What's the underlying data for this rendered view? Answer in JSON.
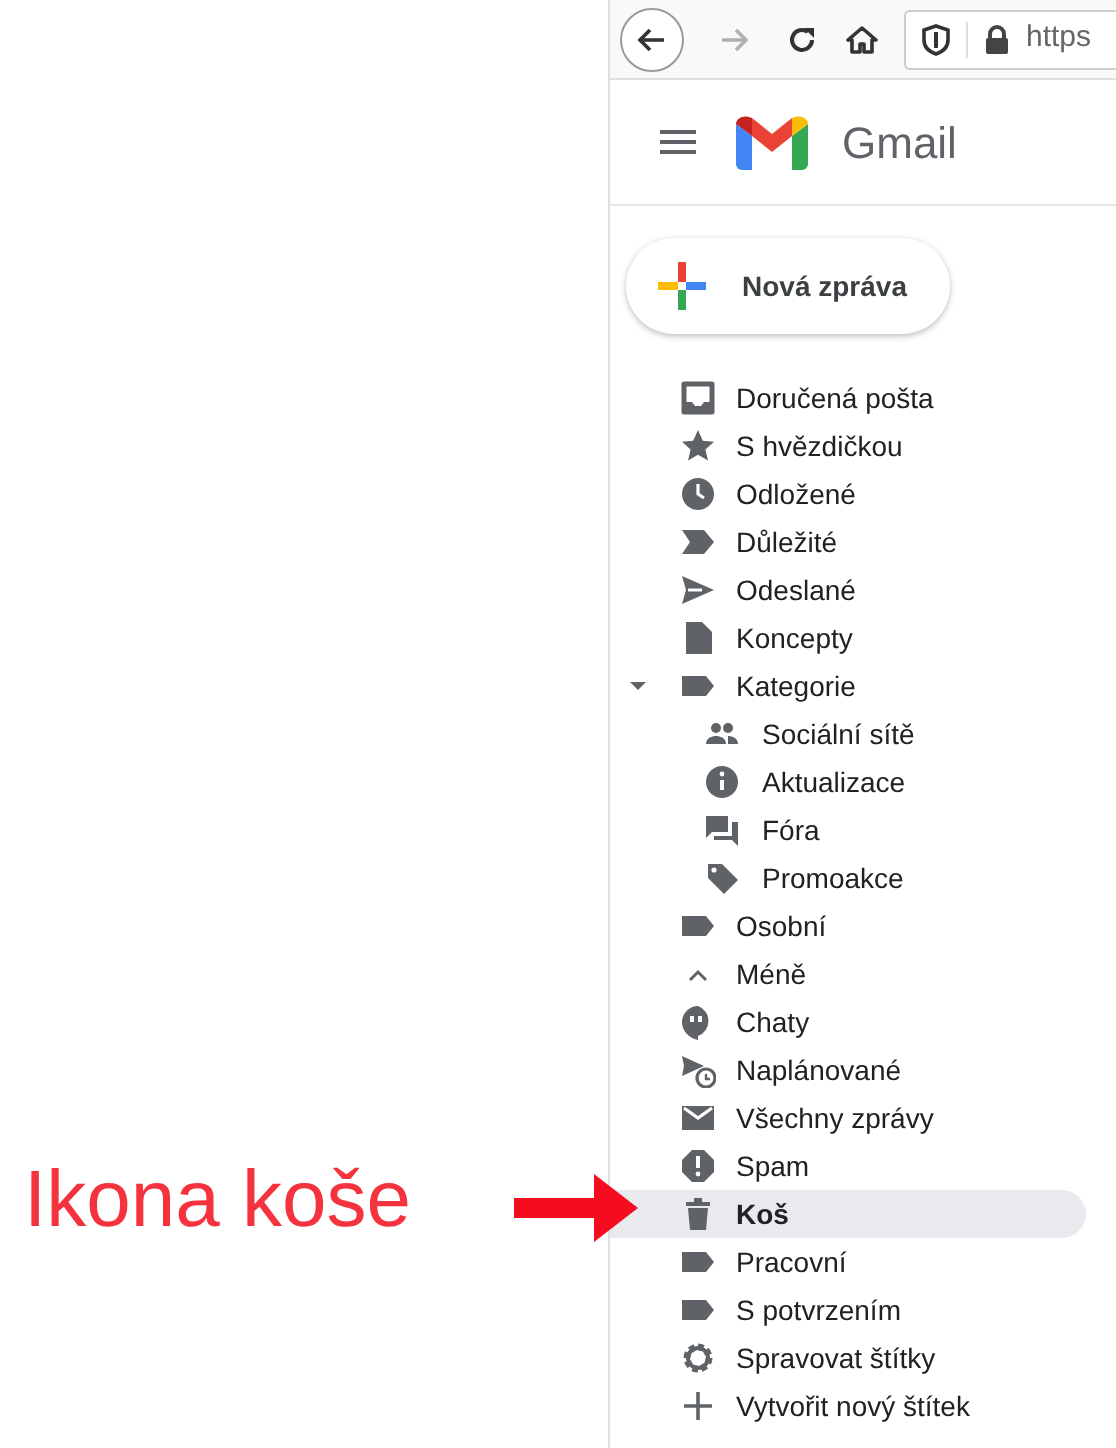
{
  "browser": {
    "url": "https"
  },
  "header": {
    "app_name": "Gmail"
  },
  "compose": {
    "label": "Nová zpráva"
  },
  "nav": {
    "items": [
      {
        "label": "Doručená pošta",
        "selected": false
      },
      {
        "label": "S hvězdičkou",
        "selected": false
      },
      {
        "label": "Odložené",
        "selected": false
      },
      {
        "label": "Důležité",
        "selected": false
      },
      {
        "label": "Odeslané",
        "selected": false
      },
      {
        "label": "Koncepty",
        "selected": false
      },
      {
        "label": "Kategorie",
        "selected": false,
        "expanded": true,
        "children": [
          {
            "label": "Sociální sítě",
            "selected": false
          },
          {
            "label": "Aktualizace",
            "selected": false
          },
          {
            "label": "Fóra",
            "selected": false
          },
          {
            "label": "Promoakce",
            "selected": false
          }
        ]
      },
      {
        "label": "Osobní",
        "selected": false
      },
      {
        "label": "Méně",
        "selected": false
      },
      {
        "label": "Chaty",
        "selected": false
      },
      {
        "label": "Naplánované",
        "selected": false
      },
      {
        "label": "Všechny zprávy",
        "selected": false
      },
      {
        "label": "Spam",
        "selected": false
      },
      {
        "label": "Koš",
        "selected": true
      },
      {
        "label": "Pracovní",
        "selected": false
      },
      {
        "label": "S potvrzením",
        "selected": false
      },
      {
        "label": "Spravovat štítky",
        "selected": false
      },
      {
        "label": "Vytvořit nový štítek",
        "selected": false
      }
    ]
  },
  "annotation": {
    "text": "Ikona koše"
  }
}
